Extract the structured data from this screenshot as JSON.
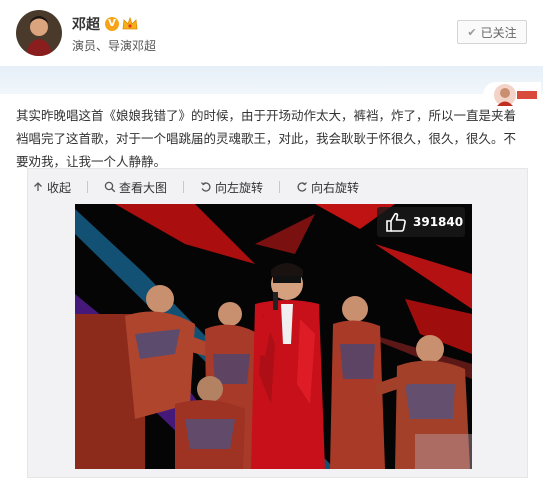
{
  "user": {
    "name": "邓超",
    "verified_badge": "V",
    "subtitle": "演员、导演邓超",
    "follow_label": "已关注",
    "follow_icon": "check-icon"
  },
  "post": {
    "text_prefix": "其实昨晚唱这首",
    "song_title": "《娘娘我错了》",
    "text_suffix": "的时候，由于开场动作太大，裤裆，炸了，所以一直是夹着裆唱完了这首歌，对于一个唱跳届的灵魂歌王，对此，我会耿耿于怀很久，很久，很久。不要劝我，让我一个人静静。"
  },
  "media_toolbar": {
    "collapse_label": "收起",
    "view_large_label": "查看大图",
    "rotate_left_label": "向左旋转",
    "rotate_right_label": "向右旋转"
  },
  "photo": {
    "like_count": "391840"
  },
  "colors": {
    "accent_orange": "#eb7350",
    "verified_orange": "#f7a41a",
    "stage_red": "#c8101a"
  }
}
